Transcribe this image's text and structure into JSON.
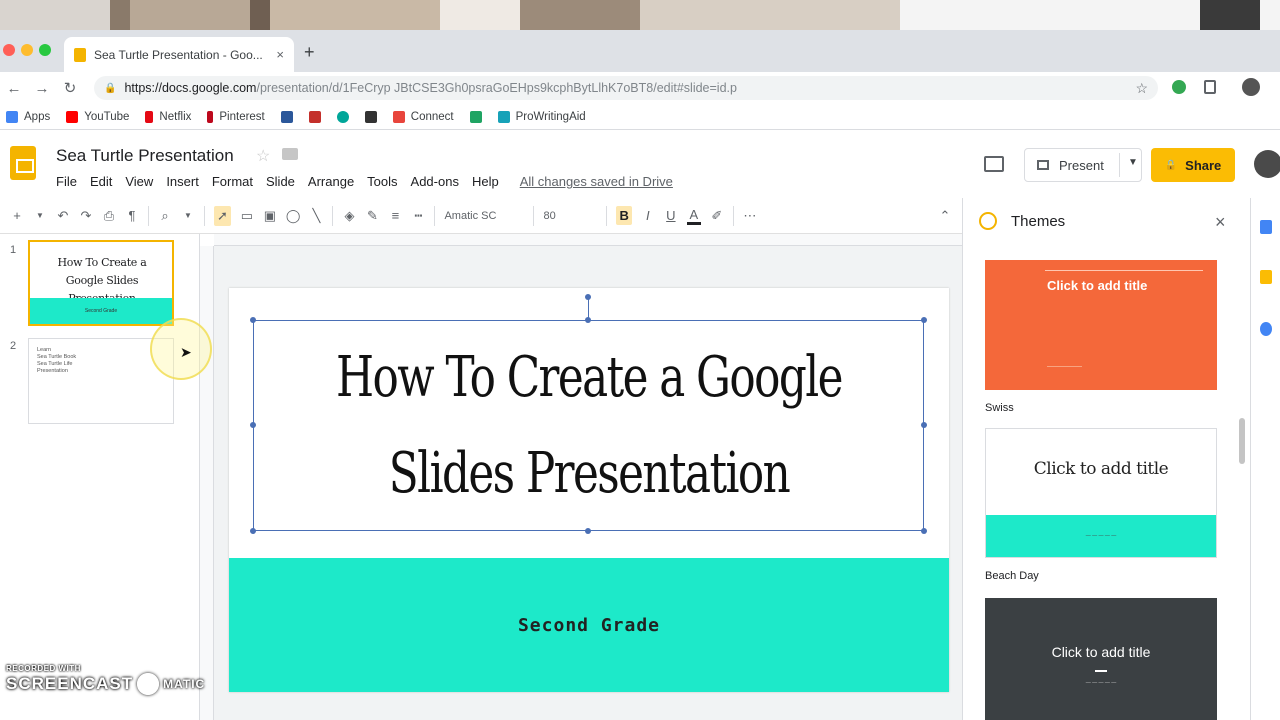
{
  "browser": {
    "tab_title": "Sea Turtle Presentation - Goo...",
    "tab_close": "×",
    "new_tab": "+",
    "url_host": "https://docs.google.com",
    "url_path": "/presentation/d/1FeCryp JBtCSE3Gh0psraGoEHps9kcphBytLlhK7oBT8/edit#slide=id.p",
    "back": "←",
    "forward": "→",
    "reload": "↻",
    "lock": "🔒",
    "star": "☆"
  },
  "bookmarks": [
    {
      "label": "Apps",
      "color": "#4285f4"
    },
    {
      "label": "YouTube",
      "color": "#ff0000"
    },
    {
      "label": "Netflix",
      "color": "#e50914"
    },
    {
      "label": "Pinterest",
      "color": "#bd081c"
    },
    {
      "label": "",
      "color": "#2b579a"
    },
    {
      "label": "",
      "color": "#c4302b"
    },
    {
      "label": "",
      "color": "#00a699"
    },
    {
      "label": "",
      "color": "#333333"
    },
    {
      "label": "Connect",
      "color": "#e8453c"
    },
    {
      "label": "",
      "color": "#1fa463"
    },
    {
      "label": "ProWritingAid",
      "color": "#17a2b8"
    }
  ],
  "doc": {
    "title": "Sea Turtle Presentation",
    "menu": [
      "File",
      "Edit",
      "View",
      "Insert",
      "Format",
      "Slide",
      "Arrange",
      "Tools",
      "Add-ons",
      "Help"
    ],
    "saved_status": "All changes saved in Drive",
    "present_label": "Present",
    "share_label": "Share",
    "share_icon": "🔒"
  },
  "toolbar": {
    "font": "Amatic SC",
    "font_size": "80",
    "bold": "B",
    "italic": "I",
    "underline": "U",
    "text_color": "A",
    "more": "⋯",
    "collapse": "⌃"
  },
  "filmstrip": {
    "slides": [
      {
        "num": "1",
        "title": "How To Create a Google Slides Presentation",
        "subtitle": "Second Grade"
      },
      {
        "num": "2",
        "lines": [
          "Learn",
          "Sea Turtle Book",
          "Sea Turtle Life",
          "Presentation"
        ]
      }
    ]
  },
  "slide": {
    "title_line1": "How To Create a Google",
    "title_line2": "Slides Presentation",
    "subtitle": "Second Grade",
    "accent_color": "#1de9c9"
  },
  "themes": {
    "header": "Themes",
    "close": "×",
    "items": [
      {
        "name": "Swiss",
        "preview_title": "Click to add title",
        "color": "#f4683a"
      },
      {
        "name": "Beach Day",
        "preview_title": "Click to add title",
        "color": "#1de9c9"
      },
      {
        "name": "",
        "preview_title": "Click to add title",
        "color": "#3b4043"
      }
    ]
  },
  "watermark": {
    "line1": "RECORDED WITH",
    "line2a": "SCREENCAST",
    "line2b": "MATIC"
  }
}
